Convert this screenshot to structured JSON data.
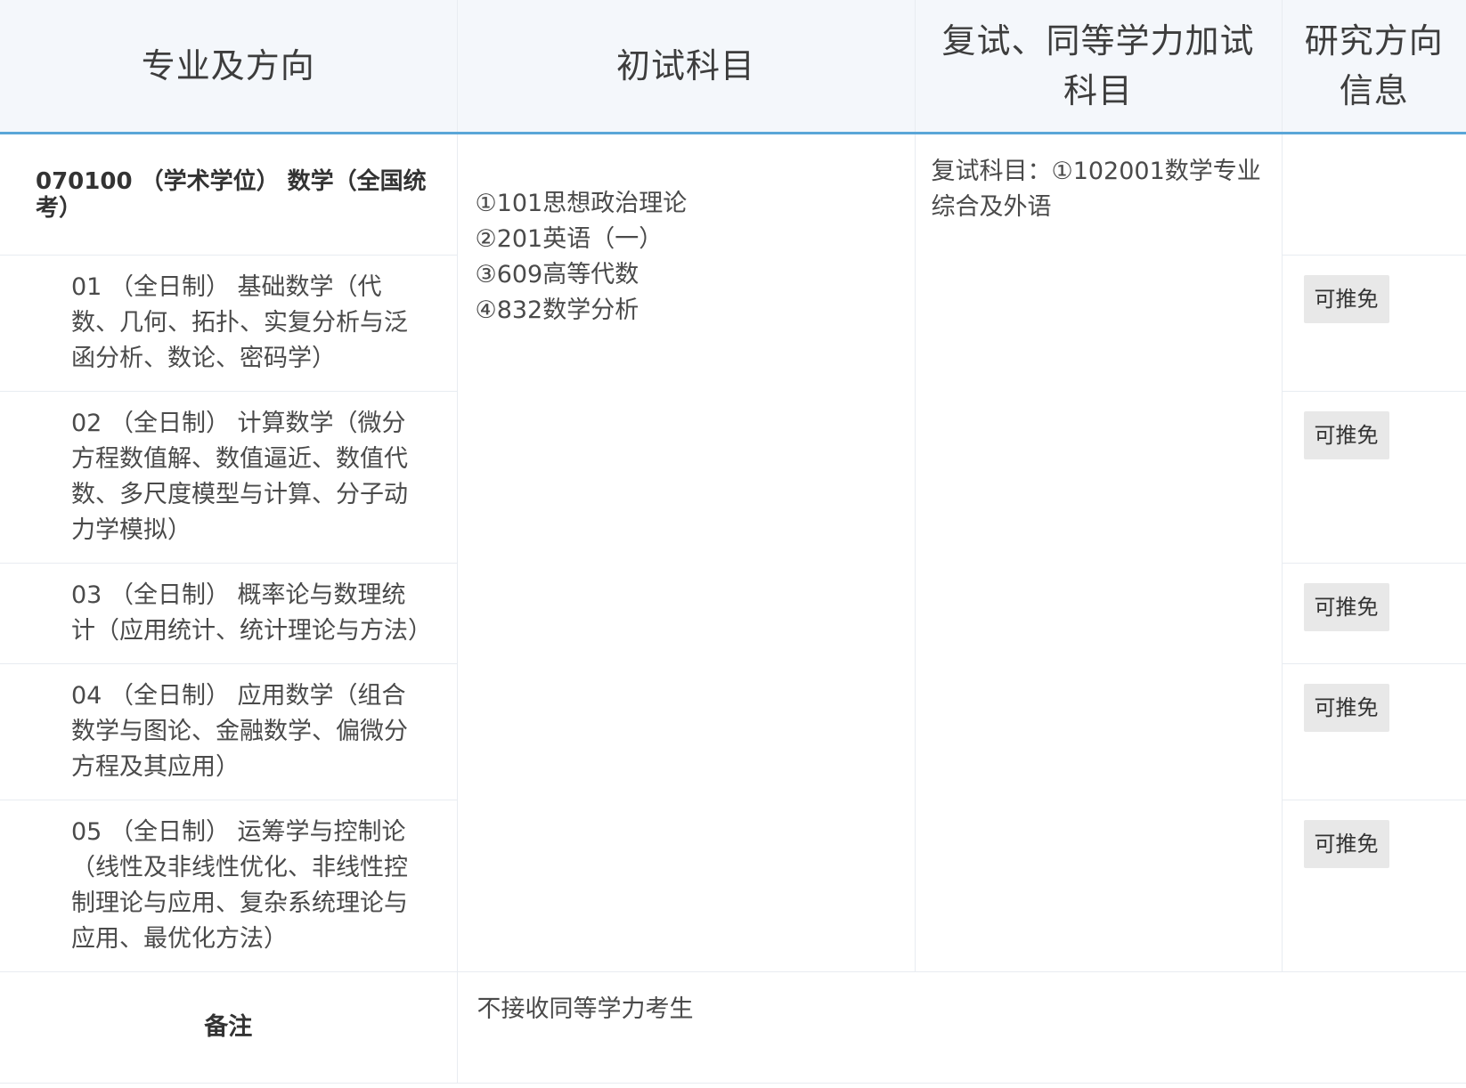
{
  "header": {
    "col1": "专业及方向",
    "col2": "初试科目",
    "col3": "复试、同等学力加试科目",
    "col4": "研究方向信息"
  },
  "major": "070100 （学术学位） 数学（全国统考）",
  "subjects": [
    "①101思想政治理论",
    "②201英语（一）",
    "③609高等代数",
    "④832数学分析"
  ],
  "retest": "复试科目：①102001数学专业综合及外语",
  "directions": [
    {
      "text": "01 （全日制） 基础数学（代数、几何、拓扑、实复分析与泛函分析、数论、密码学）",
      "badge": "可推免"
    },
    {
      "text": "02 （全日制） 计算数学（微分方程数值解、数值逼近、数值代数、多尺度模型与计算、分子动力学模拟）",
      "badge": "可推免"
    },
    {
      "text": "03 （全日制） 概率论与数理统计（应用统计、统计理论与方法）",
      "badge": "可推免"
    },
    {
      "text": "04 （全日制） 应用数学（组合数学与图论、金融数学、偏微分方程及其应用）",
      "badge": "可推免"
    },
    {
      "text": "05 （全日制） 运筹学与控制论（线性及非线性优化、非线性控制理论与应用、复杂系统理论与应用、最优化方法）",
      "badge": "可推免"
    }
  ],
  "remark": {
    "label": "备注",
    "text": "不接收同等学力考生"
  }
}
